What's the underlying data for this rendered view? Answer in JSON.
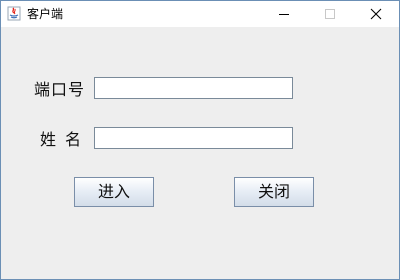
{
  "window": {
    "title": "客户端",
    "controls": {
      "minimize_icon": "minimize-icon",
      "maximize_icon": "maximize-icon",
      "close_icon": "close-icon"
    }
  },
  "form": {
    "port_label": "端口号",
    "port_value": "",
    "name_label": "姓名",
    "name_value": ""
  },
  "buttons": {
    "enter_label": "进入",
    "close_label": "关闭"
  },
  "colors": {
    "window_bg": "#eeeeee",
    "titlebar_bg": "#ffffff",
    "border": "#6b8fb5"
  }
}
